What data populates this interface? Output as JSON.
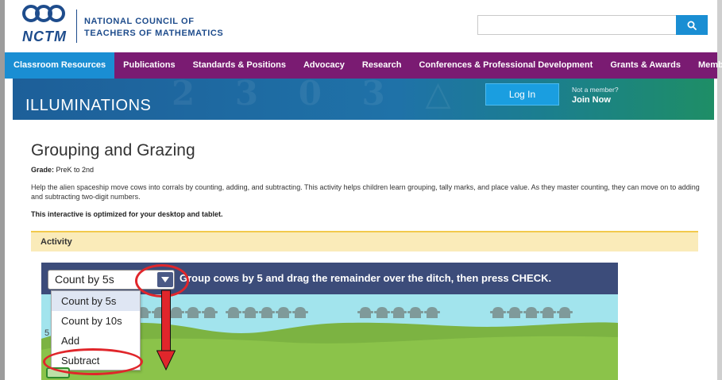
{
  "header": {
    "logo_word": "NCTM",
    "org_name_line1": "NATIONAL COUNCIL OF",
    "org_name_line2": "TEACHERS OF MATHEMATICS",
    "search_placeholder": "",
    "search_icon": "search-icon"
  },
  "nav": {
    "items": [
      {
        "label": "Classroom Resources",
        "active": true
      },
      {
        "label": "Publications"
      },
      {
        "label": "Standards & Positions"
      },
      {
        "label": "Advocacy"
      },
      {
        "label": "Research"
      },
      {
        "label": "Conferences & Professional Development"
      },
      {
        "label": "Grants & Awards"
      },
      {
        "label": "Membership"
      }
    ],
    "bg_color": "#7a1b72",
    "active_color": "#1a8ed3"
  },
  "banner": {
    "title": "ILLUMINATIONS",
    "login_label": "Log In",
    "not_member_text": "Not a member?",
    "join_label": "Join Now"
  },
  "page": {
    "title": "Grouping and Grazing",
    "grade_label": "Grade:",
    "grade_value": "PreK to 2nd",
    "description": "Help the alien spaceship move cows into corrals by counting, adding, and subtracting. This activity helps children learn grouping, tally marks, and place value. As they master counting, they can move on to adding and subtracting two-digit numbers.",
    "optimized_note": "This interactive is optimized for your desktop and tablet.",
    "activity_label": "Activity"
  },
  "game": {
    "selected_option": "Count by 5s",
    "instruction": "Group cows by 5 and drag the remainder over the ditch, then press CHECK.",
    "options": [
      "Count by 5s",
      "Count by 10s",
      "Add",
      "Subtract"
    ],
    "side_snippet": "5",
    "cow_groups": [
      5,
      5,
      5,
      5,
      4
    ]
  },
  "annotations": {
    "color": "#e0262b"
  }
}
